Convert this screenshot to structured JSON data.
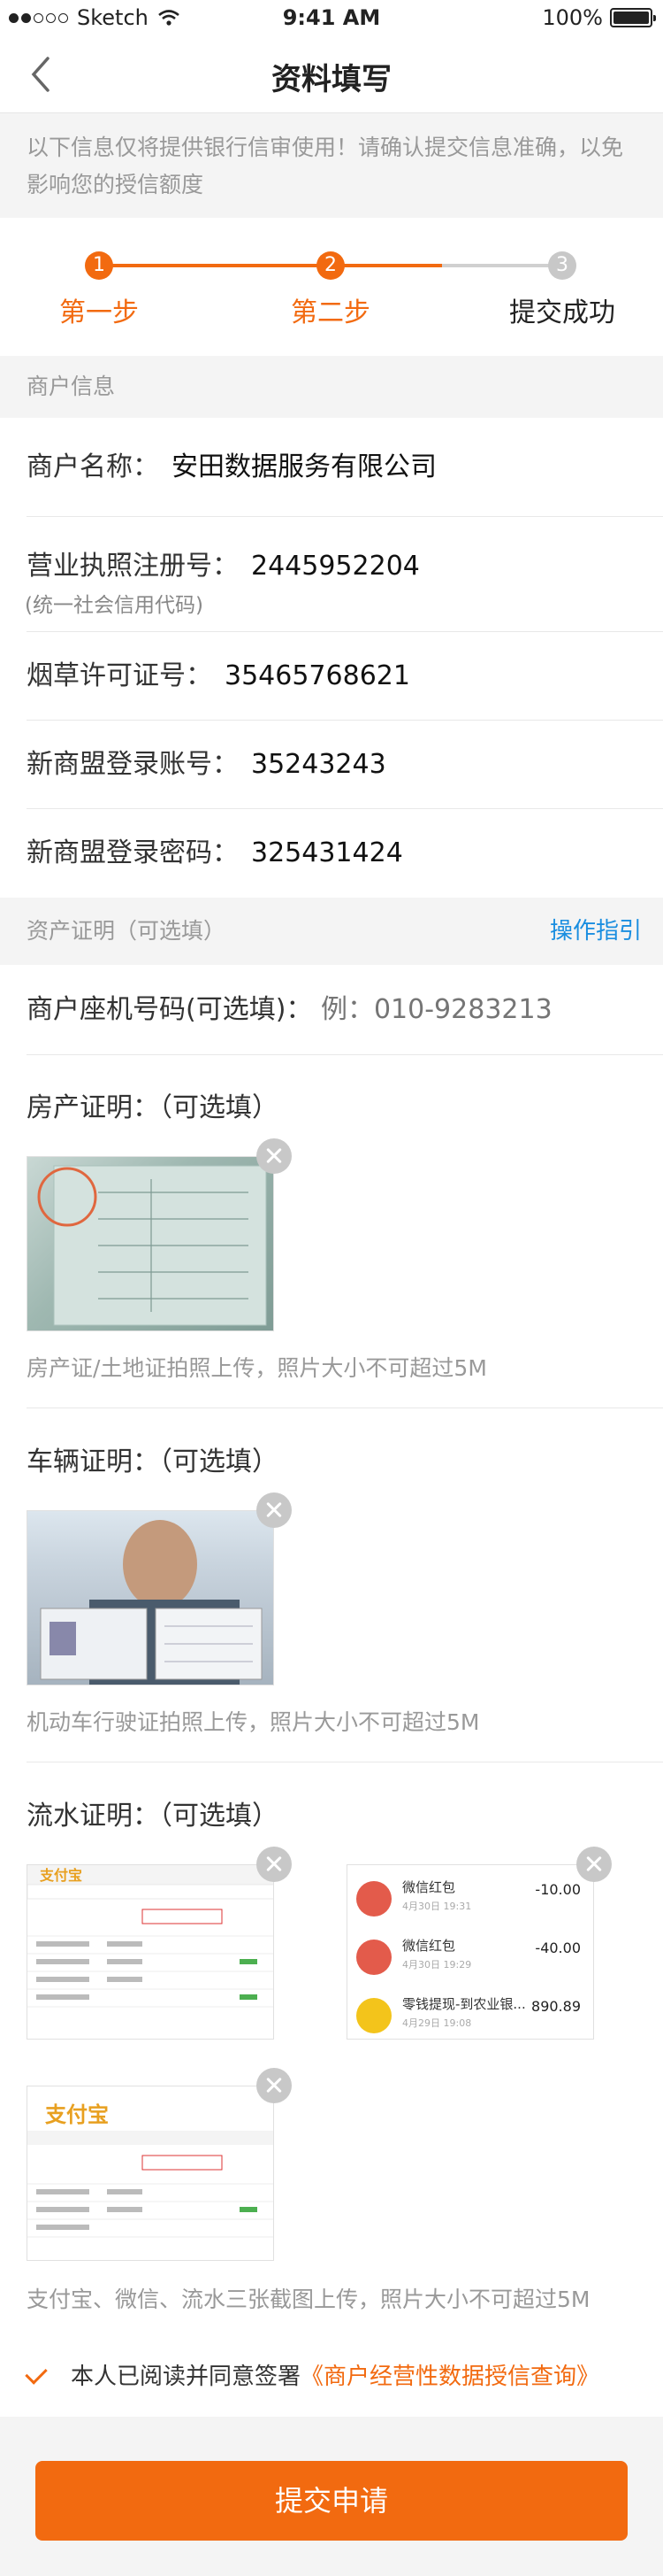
{
  "status": {
    "carrier": "Sketch",
    "time": "9:41 AM",
    "battery": "100%"
  },
  "nav": {
    "title": "资料填写"
  },
  "notice": "以下信息仅将提供银行信审使用！请确认提交信息准确，以免影响您的授信额度",
  "steps": [
    {
      "num": "1",
      "label": "第一步"
    },
    {
      "num": "2",
      "label": "第二步"
    },
    {
      "num": "3",
      "label": "提交成功"
    }
  ],
  "merchant": {
    "section_title": "商户信息",
    "name_label": "商户名称：",
    "name_value": "安田数据服务有限公司",
    "license_label": "营业执照注册号：",
    "license_value": "2445952204",
    "license_sub": "(统一社会信用代码)",
    "tobacco_label": "烟草许可证号：",
    "tobacco_value": "35465768621",
    "account_label": "新商盟登录账号：",
    "account_value": "35243243",
    "password_label": "新商盟登录密码：",
    "password_value": "325431424"
  },
  "assets": {
    "section_title": "资产证明（可选填）",
    "guide_link": "操作指引",
    "phone_label": "商户座机号码(可选填)：",
    "phone_placeholder": "例：010-9283213",
    "house_title": "房产证明：（可选填）",
    "house_hint": "房产证/土地证拍照上传，照片大小不可超过5M",
    "car_title": "车辆证明：（可选填）",
    "car_hint": "机动车行驶证拍照上传，照片大小不可超过5M",
    "flow_title": "流水证明：（可选填）",
    "flow_hint": "支付宝、微信、流水三张截图上传，照片大小不可超过5M",
    "wechat_items": [
      {
        "title": "微信红包",
        "date": "4月30日 19:31",
        "amount": "-10.00"
      },
      {
        "title": "微信红包",
        "date": "4月30日 19:29",
        "amount": "-40.00"
      },
      {
        "title": "零钱提现-到农业银...",
        "date": "4月29日 19:08",
        "amount": "890.89"
      }
    ],
    "alipay_logo": "支付宝"
  },
  "agree": {
    "text": "本人已阅读并同意签署",
    "link": "《商户经营性数据授信查询》"
  },
  "submit_label": "提交申请",
  "colors": {
    "accent": "#f26a10",
    "link": "#1a8ee0",
    "inactive": "#c8c8c8"
  }
}
